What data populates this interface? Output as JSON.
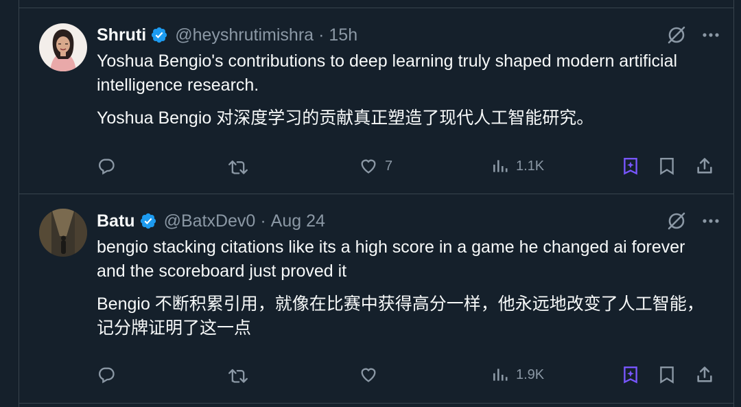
{
  "tweets": [
    {
      "name": "Shruti",
      "handle": "@heyshrutimishra",
      "separator": "·",
      "time": "15h",
      "text": "Yoshua Bengio's contributions to deep learning truly shaped modern artificial intelligence research.",
      "translation": "Yoshua Bengio 对深度学习的贡献真正塑造了现代人工智能研究。",
      "likes": "7",
      "views": "1.1K"
    },
    {
      "name": "Batu",
      "handle": "@BatxDev0",
      "separator": "·",
      "time": "Aug 24",
      "text": "bengio stacking citations like its a high score in a game he changed ai forever and the scoreboard just proved it",
      "translation": "Bengio 不断积累引用，就像在比赛中获得高分一样，他永远地改变了人工智能，记分牌证明了这一点",
      "likes": "",
      "views": "1.9K"
    }
  ],
  "colors": {
    "background": "#15202b",
    "border": "#38444d",
    "text": "#f7f9f9",
    "muted": "#8b98a5",
    "verified": "#1d9bf0",
    "grok": "#7856ff"
  },
  "icons": [
    "verified-badge-icon",
    "grok-translate-icon",
    "more-icon",
    "reply-icon",
    "retweet-icon",
    "like-icon",
    "views-icon",
    "grok-icon",
    "bookmark-icon",
    "share-icon"
  ]
}
